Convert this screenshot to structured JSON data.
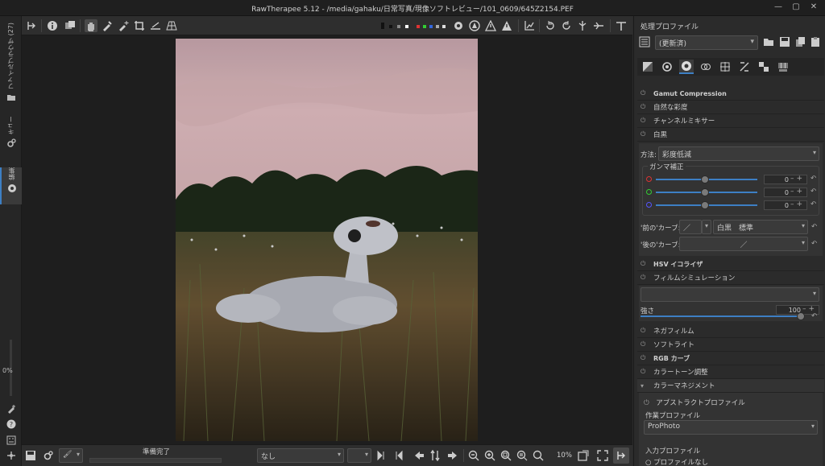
{
  "window": {
    "title": "RawTherapee 5.12 - /media/gahaku/日常写真/現像ソフトレビュー/101_0609/645Z2154.PEF"
  },
  "left_tabs": {
    "file_browser": "ファイルブラウザ (27)",
    "queue": "キュー",
    "editor": "編集",
    "zoom_percent": "0%"
  },
  "status": {
    "text": "準備完了",
    "zoom": "10%"
  },
  "bottom": {
    "profile_combo": "なし"
  },
  "right": {
    "profile_header": "処理プロファイル",
    "profile_value": "(更新済)",
    "sections": {
      "gamut": "Gamut Compression",
      "vibrance": "自然な彩度",
      "channel_mixer": "チャンネルミキサー",
      "bw": "白黒",
      "method_label": "方法:",
      "method_value": "彩度低減",
      "gamma_label": "ガンマ補正",
      "gamma_r": "0",
      "gamma_g": "0",
      "gamma_b": "0",
      "before_curve": "'前の'カーブ:",
      "before_curve_value": "白黒　標準",
      "after_curve": "'後の'カーブ:",
      "hsv": "HSV イコライザ",
      "film": "フィルムシミュレーション",
      "strength_label": "強さ",
      "strength_value": "100",
      "negative": "ネガフィルム",
      "softlight": "ソフトライト",
      "rgb_curves": "RGB カーブ",
      "color_toning": "カラートーン調整",
      "color_mgmt": "カラーマネジメント",
      "abstract_profile": "アブストラクトプロファイル",
      "working_profile": "作業プロファイル",
      "working_value": "ProPhoto",
      "input_profile": "入力プロファイル",
      "no_profile": "プロファイルなし"
    }
  },
  "colors": {
    "accent": "#3d7fc4",
    "bg": "#2b2b2b"
  }
}
